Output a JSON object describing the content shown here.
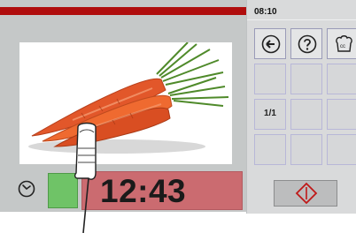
{
  "status": {
    "time": "08:10"
  },
  "timer": {
    "display": "12:43"
  },
  "grid": {
    "cell_r3c0_label": "1/1"
  },
  "icons": {
    "back": "back-arrow-icon",
    "help": "help-icon",
    "cook_mode": "chef-hat-cc-icon",
    "timer": "clock-icon",
    "start": "start-stop-diamond-icon"
  },
  "colors": {
    "top_bar": "#b00d0d",
    "timer_bg": "#cb6b70",
    "status_green": "#6fc367",
    "start_icon": "#c01818"
  }
}
